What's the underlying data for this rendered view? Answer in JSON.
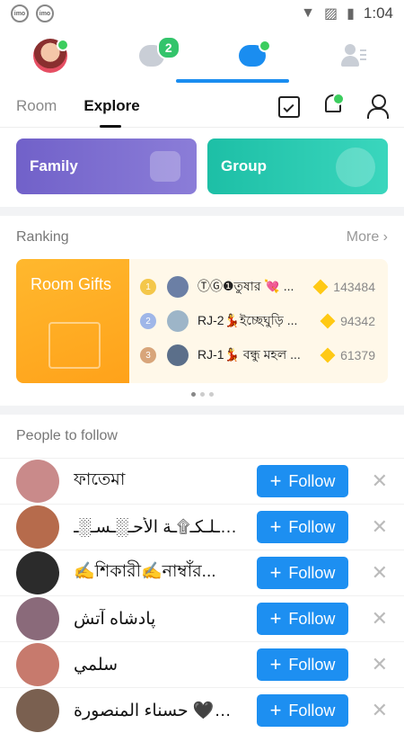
{
  "status_bar": {
    "time": "1:04",
    "app_icon_text": "imo"
  },
  "top_nav": {
    "chat_badge": "2"
  },
  "subtabs": [
    {
      "label": "Room"
    },
    {
      "label": "Explore"
    }
  ],
  "cards": {
    "family": "Family",
    "group": "Group"
  },
  "ranking": {
    "title": "Ranking",
    "more": "More",
    "banner": "Room Gifts",
    "rows": [
      {
        "rank": "1",
        "name": "ⓉⒼ❶তুষার 💘 ...",
        "score": "143484"
      },
      {
        "rank": "2",
        "name": "RJ-2💃ইচ্ছেঘুড়ি ...",
        "score": "94342"
      },
      {
        "rank": "3",
        "name": "RJ-1💃 বন্ধু মহল ...",
        "score": "61379"
      }
    ]
  },
  "people": {
    "title": "People to follow",
    "follow_label": "Follow",
    "items": [
      {
        "name": "ফাতেমা",
        "color": "#c98a8a"
      },
      {
        "name": "مـ۞ـلـكـ۩ـة الأحـ░ـسـ░ـ",
        "color": "#b66b4c"
      },
      {
        "name": "✍️শিকারী✍️নাম্বাঁর...",
        "color": "#2b2b2b"
      },
      {
        "name": "پادشاه آتش",
        "color": "#8a6a7a"
      },
      {
        "name": "سلمي",
        "color": "#c77a6d"
      },
      {
        "name": "حسناء المنصورة 🖤🖤🖤",
        "color": "#7a6050"
      }
    ]
  }
}
